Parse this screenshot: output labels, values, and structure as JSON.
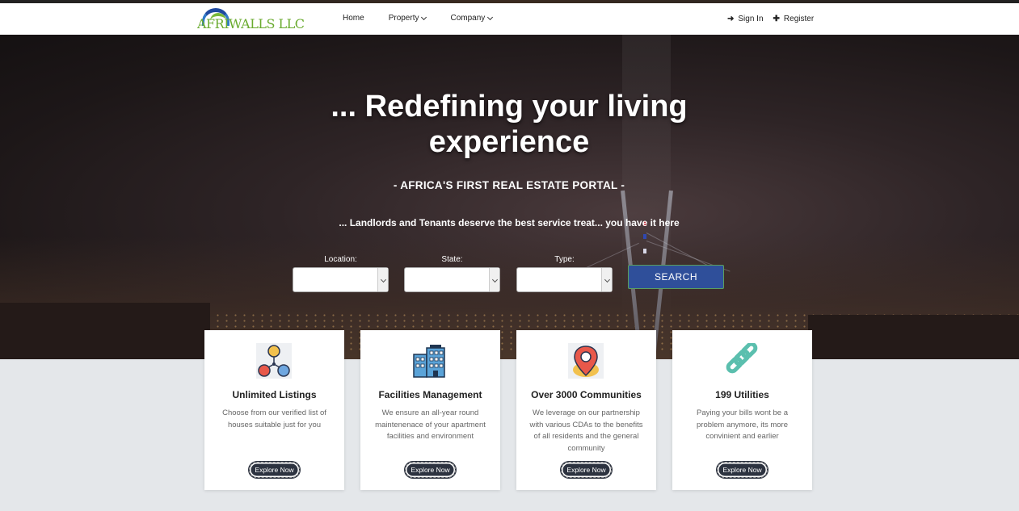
{
  "brand": {
    "logo_text": "AFRIWALLS LLC"
  },
  "nav": {
    "items": [
      {
        "label": "Home",
        "dropdown": false
      },
      {
        "label": "Property",
        "dropdown": true
      },
      {
        "label": "Company",
        "dropdown": true
      }
    ]
  },
  "auth": {
    "sign_in": "Sign In",
    "register": "Register"
  },
  "hero": {
    "title": "... Redefining your living experience",
    "subtitle": "- AFRICA'S FIRST REAL ESTATE PORTAL -",
    "tagline": "... Landlords and Tenants deserve the best service treat... you have it here"
  },
  "search": {
    "location_label": "Location:",
    "state_label": "State:",
    "type_label": "Type:",
    "location_value": "",
    "state_value": "",
    "type_value": "",
    "button": "SEARCH"
  },
  "cards": [
    {
      "icon": "network-people-icon",
      "title": "Unlimited Listings",
      "desc": "Choose from our verified list of houses suitable just for you",
      "button": "Explore Now"
    },
    {
      "icon": "building-icon",
      "title": "Facilities Management",
      "desc": "We ensure an all-year round maintenenace of your apartment facilities and environment",
      "button": "Explore Now"
    },
    {
      "icon": "map-pin-icon",
      "title": "Over 3000 Communities",
      "desc": "We leverage on our partnership with various CDAs to the benefits of all residents and the general community",
      "button": "Explore Now"
    },
    {
      "icon": "chain-link-icon",
      "title": "199 Utilities",
      "desc": "Paying your bills wont be a problem anymore, its more convinient and earlier",
      "button": "Explore Now"
    }
  ],
  "colors": {
    "brand_green": "#6aab2f",
    "brand_blue": "#1f4aa0",
    "search_button": "#2f4f9a",
    "card_button": "#2d3340"
  }
}
